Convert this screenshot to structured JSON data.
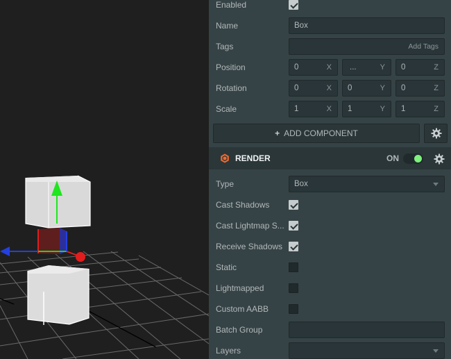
{
  "entity": {
    "enabled_label": "Enabled",
    "enabled": true,
    "name_label": "Name",
    "name_value": "Box",
    "tags_label": "Tags",
    "tags_placeholder": "Add Tags",
    "position_label": "Position",
    "position": [
      "0",
      "...",
      "0"
    ],
    "rotation_label": "Rotation",
    "rotation": [
      "0",
      "0",
      "0"
    ],
    "scale_label": "Scale",
    "scale": [
      "1",
      "1",
      "1"
    ],
    "axes": [
      "X",
      "Y",
      "Z"
    ],
    "add_component_label": "ADD COMPONENT",
    "add_component_icon": "plus-icon"
  },
  "render": {
    "title": "RENDER",
    "toggle_label": "ON",
    "toggle_on": true,
    "icon": "render-component-icon",
    "type_label": "Type",
    "type_value": "Box",
    "cast_shadows_label": "Cast Shadows",
    "cast_shadows": true,
    "cast_lightmap_label": "Cast Lightmap S...",
    "cast_lightmap": true,
    "receive_shadows_label": "Receive Shadows",
    "receive_shadows": true,
    "static_label": "Static",
    "static": false,
    "lightmapped_label": "Lightmapped",
    "lightmapped": false,
    "custom_aabb_label": "Custom AABB",
    "custom_aabb": false,
    "batch_group_label": "Batch Group",
    "batch_group_value": "",
    "layers_label": "Layers",
    "layers_value": ""
  },
  "colors": {
    "panel_bg": "#364346",
    "field_bg": "#293538",
    "viewport_bg": "#1f1f1f",
    "accent_render": "#f26a2e",
    "toggle_on": "#7ef17e",
    "gizmo_x": "#e21d1d",
    "gizmo_y": "#1fe61f",
    "gizmo_z": "#1a2fd6"
  }
}
